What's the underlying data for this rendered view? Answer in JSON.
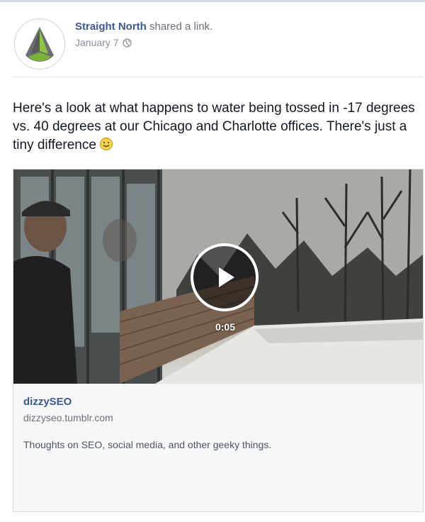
{
  "post": {
    "author": "Straight North",
    "action": " shared a link.",
    "date": "January 7",
    "privacy_icon": "globe-icon",
    "message": "Here's a look at what happens to water being tossed in -17 degrees vs. 40 degrees at our Chicago and Charlotte offices. There's just a tiny difference",
    "emoji_icon": "smiley-icon"
  },
  "video": {
    "duration": "0:05",
    "play_icon": "play-icon"
  },
  "link": {
    "title": "dizzySEO",
    "domain": "dizzyseo.tumblr.com",
    "description": "Thoughts on SEO, social media, and other geeky things."
  },
  "colors": {
    "link_blue": "#3b5998",
    "logo_green": "#8cc63f",
    "logo_gray": "#6d6e71"
  }
}
